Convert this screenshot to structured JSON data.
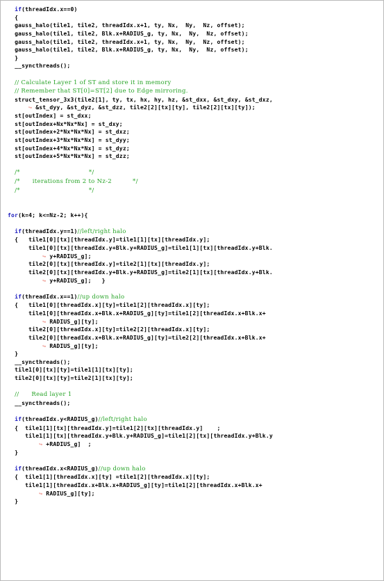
{
  "figure": {
    "kind": "code-listing",
    "language": "CUDA C",
    "colors": {
      "keyword": "#2020c0",
      "comment": "#28a428",
      "code": "#000000",
      "wrap_arrow": "#e8756a",
      "frame_border": "#b9b9b9",
      "background": "#ffffff"
    },
    "wrap_arrow_glyph": "↪"
  },
  "code": {
    "lines": [
      {
        "id": 1,
        "indent": 2,
        "tokens": [
          {
            "t": "kw",
            "v": "if"
          },
          {
            "t": "cd",
            "v": "(threadIdx.x==0)"
          }
        ]
      },
      {
        "id": 2,
        "indent": 2,
        "tokens": [
          {
            "t": "cd",
            "v": "{"
          }
        ]
      },
      {
        "id": 3,
        "indent": 2,
        "tokens": [
          {
            "t": "cd",
            "v": "gauss_halo(tile1, tile2, threadIdx.x+1, ty, Nx,  Ny,  Nz, offset);"
          }
        ]
      },
      {
        "id": 4,
        "indent": 2,
        "tokens": [
          {
            "t": "cd",
            "v": "gauss_halo(tile1, tile2, Blk.x+RADIUS_g, ty, Nx,  Ny,  Nz, offset);"
          }
        ]
      },
      {
        "id": 5,
        "indent": 2,
        "tokens": [
          {
            "t": "cd",
            "v": "gauss_halo(tile1, tile2, threadIdx.x+1, ty, Nx,  Ny,  Nz, offset);"
          }
        ]
      },
      {
        "id": 6,
        "indent": 2,
        "tokens": [
          {
            "t": "cd",
            "v": "gauss_halo(tile1, tile2, Blk.x+RADIUS_g, ty, Nx,  Ny,  Nz, offset);"
          }
        ]
      },
      {
        "id": 7,
        "indent": 2,
        "tokens": [
          {
            "t": "cd",
            "v": "}"
          }
        ]
      },
      {
        "id": 8,
        "indent": 2,
        "tokens": [
          {
            "t": "cd",
            "v": "__syncthreads();"
          }
        ]
      },
      {
        "id": 9,
        "blank": true,
        "tokens": []
      },
      {
        "id": 10,
        "indent": 2,
        "tokens": [
          {
            "t": "cm",
            "v": "// Calculate Layer 1 of ST and store it in memory"
          }
        ]
      },
      {
        "id": 11,
        "indent": 2,
        "tokens": [
          {
            "t": "cm",
            "v": "// Remember that ST[0]=ST[2] due to Edge mirroring."
          }
        ]
      },
      {
        "id": 12,
        "indent": 2,
        "tokens": [
          {
            "t": "cd",
            "v": "struct_tensor_3x3(tile2[1], ty, tx, hx, hy, hz, &st_dxx, &st_dxy, &st_dxz,"
          }
        ]
      },
      {
        "id": 13,
        "indent": 6,
        "tokens": [
          {
            "t": "arw",
            "v": "↪ "
          },
          {
            "t": "cd",
            "v": "&st_dyy, &st_dyz, &st_dzz, tile2[2][tx][ty], tile2[2][tx][ty]);"
          }
        ]
      },
      {
        "id": 14,
        "indent": 2,
        "tokens": [
          {
            "t": "cd",
            "v": "st[outIndex] = st_dxx;"
          }
        ]
      },
      {
        "id": 15,
        "indent": 2,
        "tokens": [
          {
            "t": "cd",
            "v": "st[outIndex+Nx*Nx*Nx] = st_dxy;"
          }
        ]
      },
      {
        "id": 16,
        "indent": 2,
        "tokens": [
          {
            "t": "cd",
            "v": "st[outIndex+2*Nx*Nx*Nx] = st_dxz;"
          }
        ]
      },
      {
        "id": 17,
        "indent": 2,
        "tokens": [
          {
            "t": "cd",
            "v": "st[outIndex+3*Nx*Nx*Nx] = st_dyy;"
          }
        ]
      },
      {
        "id": 18,
        "indent": 2,
        "tokens": [
          {
            "t": "cd",
            "v": "st[outIndex+4*Nx*Nx*Nx] = st_dyz;"
          }
        ]
      },
      {
        "id": 19,
        "indent": 2,
        "tokens": [
          {
            "t": "cd",
            "v": "st[outIndex+5*Nx*Nx*Nx] = st_dzz;"
          }
        ]
      },
      {
        "id": 20,
        "blank": true,
        "tokens": []
      },
      {
        "id": 21,
        "indent": 2,
        "tokens": [
          {
            "t": "cm",
            "v": "/*                                 */"
          }
        ]
      },
      {
        "id": 22,
        "indent": 2,
        "tokens": [
          {
            "t": "cm",
            "v": "/*      iterations from 2 to Nz-2          */"
          }
        ]
      },
      {
        "id": 23,
        "indent": 2,
        "tokens": [
          {
            "t": "cm",
            "v": "/*                                 */"
          }
        ]
      },
      {
        "id": 24,
        "blank": true,
        "tokens": []
      },
      {
        "id": 25,
        "blank": true,
        "tokens": []
      },
      {
        "id": 26,
        "indent": 0,
        "tokens": [
          {
            "t": "kw",
            "v": "for"
          },
          {
            "t": "cd",
            "v": "(k=4; k<=Nz-2; k++){"
          }
        ]
      },
      {
        "id": 27,
        "blank": true,
        "tokens": []
      },
      {
        "id": 28,
        "indent": 2,
        "tokens": [
          {
            "t": "kw",
            "v": "if"
          },
          {
            "t": "cd",
            "v": "(threadIdx.y==1)"
          },
          {
            "t": "cm",
            "v": "//left/right halo"
          }
        ]
      },
      {
        "id": 29,
        "indent": 2,
        "tokens": [
          {
            "t": "cd",
            "v": "{   tile1[0][tx][threadIdx.y]=tile1[1][tx][threadIdx.y];"
          }
        ]
      },
      {
        "id": 30,
        "indent": 6,
        "tokens": [
          {
            "t": "cd",
            "v": "tile1[0][tx][threadIdx.y+Blk.y+RADIUS_g]=tile1[1][tx][threadIdx.y+Blk."
          }
        ]
      },
      {
        "id": 31,
        "indent": 10,
        "tokens": [
          {
            "t": "arw",
            "v": "↪ "
          },
          {
            "t": "cd",
            "v": "y+RADIUS_g];"
          }
        ]
      },
      {
        "id": 32,
        "indent": 6,
        "tokens": [
          {
            "t": "cd",
            "v": "tile2[0][tx][threadIdx.y]=tile2[1][tx][threadIdx.y];"
          }
        ]
      },
      {
        "id": 33,
        "indent": 6,
        "tokens": [
          {
            "t": "cd",
            "v": "tile2[0][tx][threadIdx.y+Blk.y+RADIUS_g]=tile2[1][tx][threadIdx.y+Blk."
          }
        ]
      },
      {
        "id": 34,
        "indent": 10,
        "tokens": [
          {
            "t": "arw",
            "v": "↪ "
          },
          {
            "t": "cd",
            "v": "y+RADIUS_g];   }"
          }
        ]
      },
      {
        "id": 35,
        "blank": true,
        "tokens": []
      },
      {
        "id": 36,
        "indent": 2,
        "tokens": [
          {
            "t": "kw",
            "v": "if"
          },
          {
            "t": "cd",
            "v": "(threadIdx.x==1)"
          },
          {
            "t": "cm",
            "v": "//up down halo"
          }
        ]
      },
      {
        "id": 37,
        "indent": 2,
        "tokens": [
          {
            "t": "cd",
            "v": "{   tile1[0][threadIdx.x][ty]=tile1[2][threadIdx.x][ty];"
          }
        ]
      },
      {
        "id": 38,
        "indent": 6,
        "tokens": [
          {
            "t": "cd",
            "v": "tile1[0][threadIdx.x+Blk.x+RADIUS_g][ty]=tile1[2][threadIdx.x+Blk.x+"
          }
        ]
      },
      {
        "id": 39,
        "indent": 10,
        "tokens": [
          {
            "t": "arw",
            "v": "↪ "
          },
          {
            "t": "cd",
            "v": "RADIUS_g][ty];"
          }
        ]
      },
      {
        "id": 40,
        "indent": 6,
        "tokens": [
          {
            "t": "cd",
            "v": "tile2[0][threadIdx.x][ty]=tile2[2][threadIdx.x][ty];"
          }
        ]
      },
      {
        "id": 41,
        "indent": 6,
        "tokens": [
          {
            "t": "cd",
            "v": "tile2[0][threadIdx.x+Blk.x+RADIUS_g][ty]=tile2[2][threadIdx.x+Blk.x+"
          }
        ]
      },
      {
        "id": 42,
        "indent": 10,
        "tokens": [
          {
            "t": "arw",
            "v": "↪ "
          },
          {
            "t": "cd",
            "v": "RADIUS_g][ty];"
          }
        ]
      },
      {
        "id": 43,
        "indent": 2,
        "tokens": [
          {
            "t": "cd",
            "v": "}"
          }
        ]
      },
      {
        "id": 44,
        "indent": 2,
        "tokens": [
          {
            "t": "cd",
            "v": "__syncthreads();"
          }
        ]
      },
      {
        "id": 45,
        "indent": 2,
        "tokens": [
          {
            "t": "cd",
            "v": "tile1[0][tx][ty]=tile1[1][tx][ty];"
          }
        ]
      },
      {
        "id": 46,
        "indent": 2,
        "tokens": [
          {
            "t": "cd",
            "v": "tile2[0][tx][ty]=tile2[1][tx][ty];"
          }
        ]
      },
      {
        "id": 47,
        "blank": true,
        "tokens": []
      },
      {
        "id": 48,
        "indent": 2,
        "tokens": [
          {
            "t": "cm",
            "v": "//      Read layer 1"
          }
        ]
      },
      {
        "id": 49,
        "indent": 2,
        "tokens": [
          {
            "t": "cd",
            "v": "__syncthreads();"
          }
        ]
      },
      {
        "id": 50,
        "blank": true,
        "tokens": []
      },
      {
        "id": 51,
        "indent": 2,
        "tokens": [
          {
            "t": "kw",
            "v": "if"
          },
          {
            "t": "cd",
            "v": "(threadIdx.y<RADIUS_g)"
          },
          {
            "t": "cm",
            "v": "//left/right halo"
          }
        ]
      },
      {
        "id": 52,
        "indent": 2,
        "tokens": [
          {
            "t": "cd",
            "v": "{  tile1[1][tx][threadIdx.y]=tile1[2][tx][threadIdx.y]    ;"
          }
        ]
      },
      {
        "id": 53,
        "indent": 5,
        "tokens": [
          {
            "t": "cd",
            "v": "tile1[1][tx][threadIdx.y+Blk.y+RADIUS_g]=tile1[2][tx][threadIdx.y+Blk.y"
          }
        ]
      },
      {
        "id": 54,
        "indent": 9,
        "tokens": [
          {
            "t": "arw",
            "v": "↪ "
          },
          {
            "t": "cd",
            "v": "+RADIUS_g]  ;"
          }
        ]
      },
      {
        "id": 55,
        "indent": 2,
        "tokens": [
          {
            "t": "cd",
            "v": "}"
          }
        ]
      },
      {
        "id": 56,
        "blank": true,
        "tokens": []
      },
      {
        "id": 57,
        "indent": 2,
        "tokens": [
          {
            "t": "kw",
            "v": "if"
          },
          {
            "t": "cd",
            "v": "(threadIdx.x<RADIUS_g)"
          },
          {
            "t": "cm",
            "v": "//up down halo"
          }
        ]
      },
      {
        "id": 58,
        "indent": 2,
        "tokens": [
          {
            "t": "cd",
            "v": "{  tile1[1][threadIdx.x][ty] =tile1[2][threadIdx.x][ty];"
          }
        ]
      },
      {
        "id": 59,
        "indent": 5,
        "tokens": [
          {
            "t": "cd",
            "v": "tile1[1][threadIdx.x+Blk.x+RADIUS_g][ty]=tile1[2][threadIdx.x+Blk.x+"
          }
        ]
      },
      {
        "id": 60,
        "indent": 9,
        "tokens": [
          {
            "t": "arw",
            "v": "↪ "
          },
          {
            "t": "cd",
            "v": "RADIUS_g][ty];"
          }
        ]
      },
      {
        "id": 61,
        "indent": 2,
        "tokens": [
          {
            "t": "cd",
            "v": "}"
          }
        ]
      }
    ]
  }
}
